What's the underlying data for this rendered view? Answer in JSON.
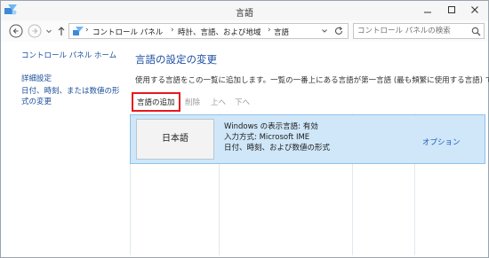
{
  "window": {
    "title": "言語"
  },
  "address": {
    "crumbs": [
      "コントロール パネル",
      "時計、言語、および地域",
      "言語"
    ]
  },
  "search": {
    "placeholder": "コントロール パネルの検索"
  },
  "sidebar": {
    "items": [
      {
        "label": "コントロール パネル ホーム"
      },
      {
        "label": "詳細設定"
      },
      {
        "label": "日付、時刻、または数値の形式の変更"
      }
    ]
  },
  "main": {
    "heading": "言語の設定の変更",
    "description": "使用する言語をこの一覧に追加します。一覧の一番上にある言語が第一言語 (最も頻繁に使用する言語) です。"
  },
  "toolbar": {
    "add_label": "言語の追加",
    "remove_label": "削除",
    "up_label": "上へ",
    "down_label": "下へ"
  },
  "languages": [
    {
      "name": "日本語",
      "display_status": "Windows の表示言語: 有効",
      "input_method": "入力方式: Microsoft IME",
      "formats": "日付、時刻、および数値の形式",
      "options_label": "オプション"
    }
  ],
  "colors": {
    "highlight_border": "#e8191d",
    "selection_bg": "#cfe7f8",
    "link": "#1b4d99",
    "heading": "#1f4fa0"
  }
}
